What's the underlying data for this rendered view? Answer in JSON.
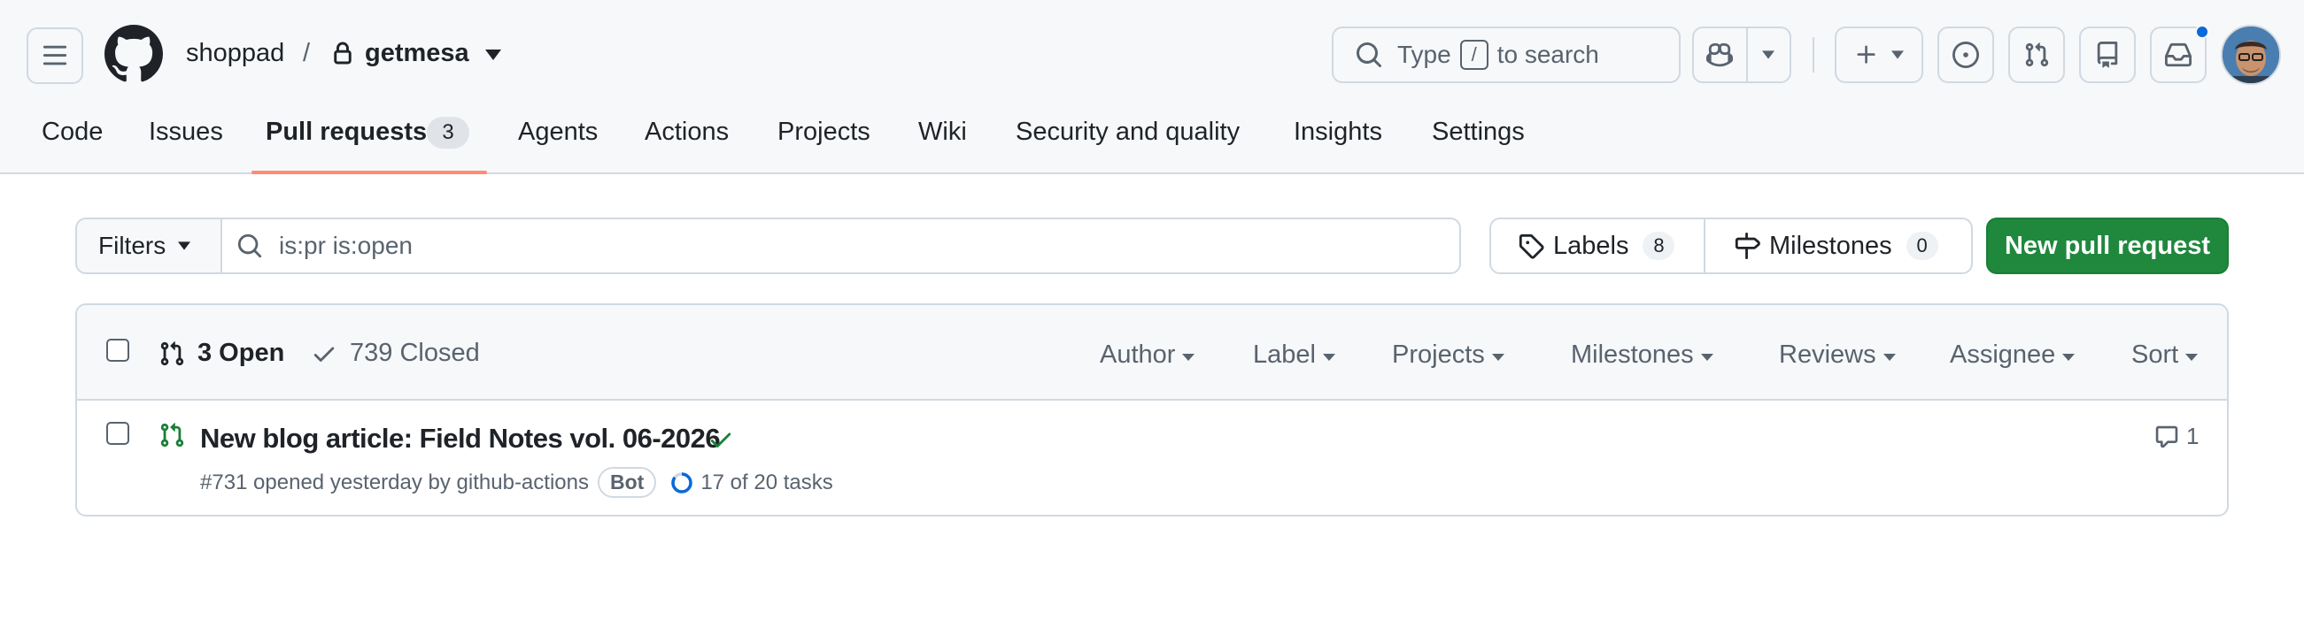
{
  "header": {
    "owner": "shoppad",
    "separator": "/",
    "repo": "getmesa",
    "search": {
      "placeholder_before": "Type",
      "shortcut": "/",
      "placeholder_after": "to search"
    }
  },
  "tabs": [
    {
      "label": "Code"
    },
    {
      "label": "Issues"
    },
    {
      "label": "Pull requests",
      "count": "3",
      "active": true
    },
    {
      "label": "Agents"
    },
    {
      "label": "Actions"
    },
    {
      "label": "Projects"
    },
    {
      "label": "Wiki"
    },
    {
      "label": "Security and quality"
    },
    {
      "label": "Insights"
    },
    {
      "label": "Settings"
    }
  ],
  "filter_bar": {
    "filters_label": "Filters",
    "query": "is:pr is:open",
    "labels_label": "Labels",
    "labels_count": "8",
    "milestones_label": "Milestones",
    "milestones_count": "0",
    "new_pr_label": "New pull request"
  },
  "list": {
    "open_label": "3 Open",
    "closed_label": "739 Closed",
    "filters": [
      "Author",
      "Label",
      "Projects",
      "Milestones",
      "Reviews",
      "Assignee",
      "Sort"
    ],
    "items": [
      {
        "title": "New blog article: Field Notes vol. 06-2026",
        "meta": "#731 opened yesterday by github-actions",
        "badge": "Bot",
        "tasks": "17 of 20 tasks",
        "tasks_done": 17,
        "tasks_total": 20,
        "comments": "1",
        "status": "success"
      }
    ]
  },
  "colors": {
    "accent_green": "#1f883d",
    "tab_underline": "#fd8c73",
    "notification": "#0969da",
    "open_icon": "#1a7f37"
  }
}
